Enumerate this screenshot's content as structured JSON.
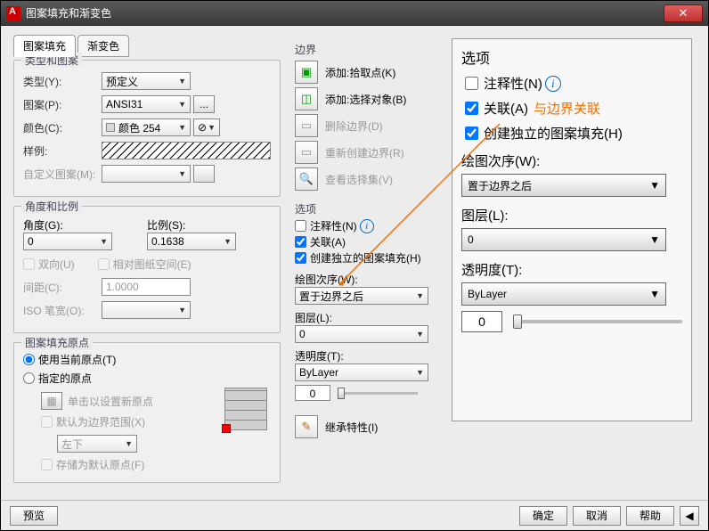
{
  "window": {
    "title": "图案填充和渐变色"
  },
  "tabs": {
    "tab1": "图案填充",
    "tab2": "渐变色"
  },
  "type_pattern": {
    "legend": "类型和图案",
    "type_label": "类型(Y):",
    "type_value": "预定义",
    "pattern_label": "图案(P):",
    "pattern_value": "ANSI31",
    "pattern_more": "...",
    "color_label": "颜色(C):",
    "color_value": "颜色 254",
    "sample_label": "样例:",
    "custom_label": "自定义图案(M):"
  },
  "angle_scale": {
    "legend": "角度和比例",
    "angle_label": "角度(G):",
    "angle_value": "0",
    "scale_label": "比例(S):",
    "scale_value": "0.1638",
    "double_label": "双向(U)",
    "relative_label": "相对图纸空间(E)",
    "spacing_label": "间距(C):",
    "spacing_value": "1.0000",
    "iso_label": "ISO 笔宽(O):"
  },
  "origin": {
    "legend": "图案填充原点",
    "use_current": "使用当前原点(T)",
    "specified": "指定的原点",
    "click_set": "单击以设置新原点",
    "default_bound": "默认为边界范围(X)",
    "pos_value": "左下",
    "store_default": "存储为默认原点(F)"
  },
  "boundary": {
    "legend": "边界",
    "add_pick": "添加:拾取点(K)",
    "add_select": "添加:选择对象(B)",
    "remove": "删除边界(D)",
    "recreate": "重新创建边界(R)",
    "view_sel": "查看选择集(V)"
  },
  "options_small": {
    "legend": "选项",
    "annotative": "注释性(N)",
    "associative": "关联(A)",
    "separate": "创建独立的图案填充(H)",
    "draw_order_label": "绘图次序(W):",
    "draw_order_value": "置于边界之后",
    "layer_label": "图层(L):",
    "layer_value": "0",
    "transparency_label": "透明度(T):",
    "transparency_value": "ByLayer",
    "transparency_num": "0"
  },
  "inherit": {
    "label": "继承特性(I)"
  },
  "big_options": {
    "title": "选项",
    "annotative": "注释性(N)",
    "associative": "关联(A)",
    "assoc_annotation": "与边界关联",
    "separate": "创建独立的图案填充(H)",
    "draw_order_label": "绘图次序(W):",
    "draw_order_value": "置于边界之后",
    "layer_label": "图层(L):",
    "layer_value": "0",
    "transparency_label": "透明度(T):",
    "transparency_value": "ByLayer",
    "transparency_num": "0"
  },
  "buttons": {
    "preview": "预览",
    "ok": "确定",
    "cancel": "取消",
    "help": "帮助"
  }
}
